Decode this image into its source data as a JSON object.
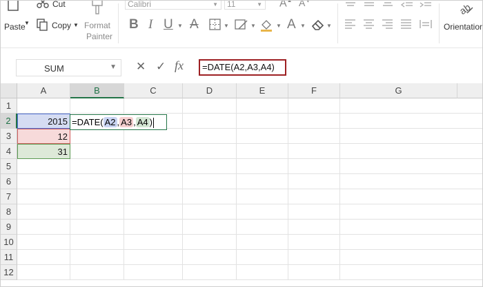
{
  "ribbon": {
    "cut_label": "Cut",
    "copy_label": "Copy",
    "paste_label": "Paste",
    "format_painter_line1": "Format",
    "format_painter_line2": "Painter",
    "font_name": "Calibri",
    "font_size": "11",
    "orientation_label": "Orientation"
  },
  "formula_bar": {
    "name_box": "SUM",
    "fx_label": "fx",
    "formula": "=DATE(A2,A3,A4)"
  },
  "grid": {
    "columns": [
      "A",
      "B",
      "C",
      "D",
      "E",
      "F",
      "G"
    ],
    "rows": [
      "1",
      "2",
      "3",
      "4",
      "5",
      "6",
      "7",
      "8",
      "9",
      "10",
      "11",
      "12"
    ],
    "cells": {
      "A2": "2015",
      "A3": "12",
      "A4": "31"
    },
    "edit": {
      "prefix": "=DATE(",
      "ref1": "A2",
      "sep1": ",",
      "ref2": "A3",
      "sep2": ",",
      "ref3": "A4",
      "suffix": ")"
    }
  },
  "colors": {
    "ref1_bg": "#c9d4f2",
    "ref2_bg": "#f5cfcf",
    "ref3_bg": "#d3e6d3",
    "formula_border": "#9d1f22",
    "accent": "#217346"
  }
}
